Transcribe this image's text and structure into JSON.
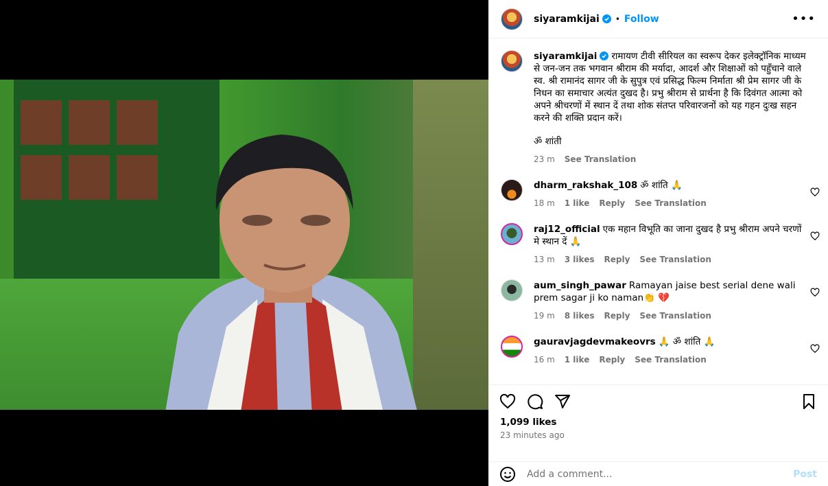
{
  "post": {
    "username": "siyaramkijai",
    "follow_label": "Follow",
    "separator": "•",
    "more_label": "•••",
    "caption_text": "रामायण टीवी सीरियल का स्वरूप देकर इलेक्ट्रॉनिक माध्यम से जन-जन तक भगवान श्रीराम की मर्यादा, आदर्श और शिक्षाओं को पहुँचाने वाले स्व. श्री रामानंद सागर जी के सुपुत्र एवं प्रसिद्ध फिल्म निर्माता श्री प्रेम सागर जी के निधन का समाचार अत्यंत दुखद है। प्रभु श्रीराम से प्रार्थना है कि दिवंगत आत्मा को अपने श्रीचरणों में स्थान दें तथा शोक संतप्त परिवारजनों को यह गहन दुःख सहन करने की शक्ति प्रदान करें।",
    "caption_tail": "ॐ शांती",
    "caption_time": "23 m",
    "see_translation": "See Translation"
  },
  "comments": [
    {
      "user": "dharm_rakshak_108",
      "text": "ॐ शांति 🙏",
      "time": "18 m",
      "likes": "1 like",
      "reply": "Reply",
      "translate": "See Translation"
    },
    {
      "user": "raj12_official",
      "text": "एक महान विभूति का जाना दुखद है प्रभु श्रीराम अपने चरणों मे स्थान दें 🙏",
      "time": "13 m",
      "likes": "3 likes",
      "reply": "Reply",
      "translate": "See Translation"
    },
    {
      "user": "aum_singh_pawar",
      "text": "Ramayan jaise best serial dene wali prem sagar ji ko naman👏 💔",
      "time": "19 m",
      "likes": "8 likes",
      "reply": "Reply",
      "translate": "See Translation"
    },
    {
      "user": "gauravjagdevmakeovrs",
      "text": "🙏 ॐ शांति 🙏",
      "time": "16 m",
      "likes": "1 like",
      "reply": "Reply",
      "translate": "See Translation"
    }
  ],
  "footer": {
    "likes": "1,099 likes",
    "time": "23 minutes ago",
    "comment_placeholder": "Add a comment...",
    "post_label": "Post"
  },
  "colors": {
    "accent": "#0095f6",
    "muted": "#737373",
    "post_disabled": "#b2dffc"
  },
  "icons": [
    "heart-icon",
    "comment-icon",
    "share-icon",
    "bookmark-icon",
    "emoji-icon",
    "verified-icon",
    "more-icon"
  ]
}
